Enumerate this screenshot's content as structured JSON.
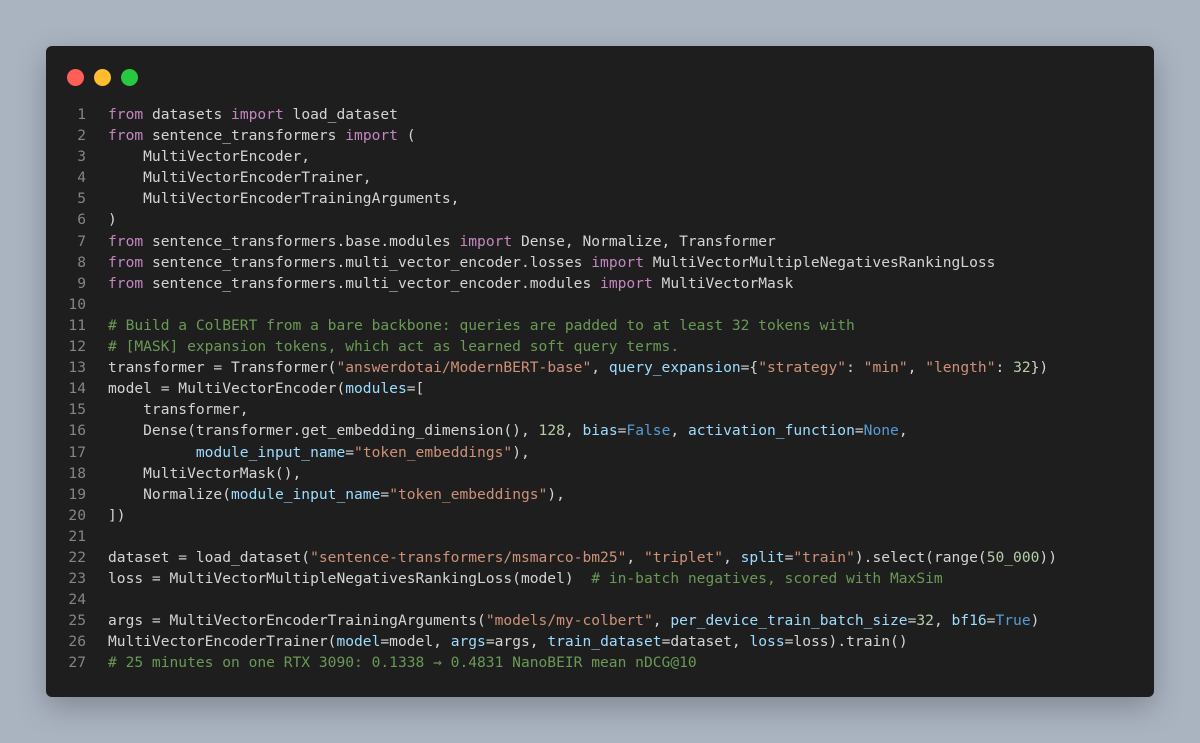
{
  "window": {
    "buttons": [
      {
        "name": "close",
        "color": "#ff5f57"
      },
      {
        "name": "minimize",
        "color": "#febc2e"
      },
      {
        "name": "maximize",
        "color": "#28c840"
      }
    ]
  },
  "colors": {
    "keyword": "#c586c0",
    "string": "#ce9178",
    "number": "#b5cea8",
    "param": "#9cdcfe",
    "constant": "#569cd6",
    "comment": "#6a9955",
    "text": "#d4d4d4"
  },
  "code_lines": [
    [
      [
        "kw",
        "from"
      ],
      [
        "t",
        " datasets "
      ],
      [
        "kw",
        "import"
      ],
      [
        "t",
        " load_dataset"
      ]
    ],
    [
      [
        "kw",
        "from"
      ],
      [
        "t",
        " sentence_transformers "
      ],
      [
        "kw",
        "import"
      ],
      [
        "t",
        " ("
      ]
    ],
    [
      [
        "t",
        "    MultiVectorEncoder,"
      ]
    ],
    [
      [
        "t",
        "    MultiVectorEncoderTrainer,"
      ]
    ],
    [
      [
        "t",
        "    MultiVectorEncoderTrainingArguments,"
      ]
    ],
    [
      [
        "t",
        ")"
      ]
    ],
    [
      [
        "kw",
        "from"
      ],
      [
        "t",
        " sentence_transformers.base.modules "
      ],
      [
        "kw",
        "import"
      ],
      [
        "t",
        " Dense, Normalize, Transformer"
      ]
    ],
    [
      [
        "kw",
        "from"
      ],
      [
        "t",
        " sentence_transformers.multi_vector_encoder.losses "
      ],
      [
        "kw",
        "import"
      ],
      [
        "t",
        " MultiVectorMultipleNegativesRankingLoss"
      ]
    ],
    [
      [
        "kw",
        "from"
      ],
      [
        "t",
        " sentence_transformers.multi_vector_encoder.modules "
      ],
      [
        "kw",
        "import"
      ],
      [
        "t",
        " MultiVectorMask"
      ]
    ],
    [],
    [
      [
        "cmt",
        "# Build a ColBERT from a bare backbone: queries are padded to at least 32 tokens with"
      ]
    ],
    [
      [
        "cmt",
        "# [MASK] expansion tokens, which act as learned soft query terms."
      ]
    ],
    [
      [
        "t",
        "transformer = Transformer("
      ],
      [
        "str",
        "\"answerdotai/ModernBERT-base\""
      ],
      [
        "t",
        ", "
      ],
      [
        "prm",
        "query_expansion"
      ],
      [
        "t",
        "={"
      ],
      [
        "str",
        "\"strategy\""
      ],
      [
        "t",
        ": "
      ],
      [
        "str",
        "\"min\""
      ],
      [
        "t",
        ", "
      ],
      [
        "str",
        "\"length\""
      ],
      [
        "t",
        ": "
      ],
      [
        "num",
        "32"
      ],
      [
        "t",
        "})"
      ]
    ],
    [
      [
        "t",
        "model = MultiVectorEncoder("
      ],
      [
        "prm",
        "modules"
      ],
      [
        "t",
        "=["
      ]
    ],
    [
      [
        "t",
        "    transformer,"
      ]
    ],
    [
      [
        "t",
        "    Dense(transformer.get_embedding_dimension(), "
      ],
      [
        "num",
        "128"
      ],
      [
        "t",
        ", "
      ],
      [
        "prm",
        "bias"
      ],
      [
        "t",
        "="
      ],
      [
        "bool",
        "False"
      ],
      [
        "t",
        ", "
      ],
      [
        "prm",
        "activation_function"
      ],
      [
        "t",
        "="
      ],
      [
        "bool",
        "None"
      ],
      [
        "t",
        ","
      ]
    ],
    [
      [
        "t",
        "          "
      ],
      [
        "prm",
        "module_input_name"
      ],
      [
        "t",
        "="
      ],
      [
        "str",
        "\"token_embeddings\""
      ],
      [
        "t",
        "),"
      ]
    ],
    [
      [
        "t",
        "    MultiVectorMask(),"
      ]
    ],
    [
      [
        "t",
        "    Normalize("
      ],
      [
        "prm",
        "module_input_name"
      ],
      [
        "t",
        "="
      ],
      [
        "str",
        "\"token_embeddings\""
      ],
      [
        "t",
        "),"
      ]
    ],
    [
      [
        "t",
        "])"
      ]
    ],
    [],
    [
      [
        "t",
        "dataset = load_dataset("
      ],
      [
        "str",
        "\"sentence-transformers/msmarco-bm25\""
      ],
      [
        "t",
        ", "
      ],
      [
        "str",
        "\"triplet\""
      ],
      [
        "t",
        ", "
      ],
      [
        "prm",
        "split"
      ],
      [
        "t",
        "="
      ],
      [
        "str",
        "\"train\""
      ],
      [
        "t",
        ").select(range("
      ],
      [
        "num",
        "50_000"
      ],
      [
        "t",
        "))"
      ]
    ],
    [
      [
        "t",
        "loss = MultiVectorMultipleNegativesRankingLoss(model)  "
      ],
      [
        "cmt",
        "# in-batch negatives, scored with MaxSim"
      ]
    ],
    [],
    [
      [
        "t",
        "args = MultiVectorEncoderTrainingArguments("
      ],
      [
        "str",
        "\"models/my-colbert\""
      ],
      [
        "t",
        ", "
      ],
      [
        "prm",
        "per_device_train_batch_size"
      ],
      [
        "t",
        "="
      ],
      [
        "num",
        "32"
      ],
      [
        "t",
        ", "
      ],
      [
        "prm",
        "bf16"
      ],
      [
        "t",
        "="
      ],
      [
        "bool",
        "True"
      ],
      [
        "t",
        ")"
      ]
    ],
    [
      [
        "t",
        "MultiVectorEncoderTrainer("
      ],
      [
        "prm",
        "model"
      ],
      [
        "t",
        "=model, "
      ],
      [
        "prm",
        "args"
      ],
      [
        "t",
        "=args, "
      ],
      [
        "prm",
        "train_dataset"
      ],
      [
        "t",
        "=dataset, "
      ],
      [
        "prm",
        "loss"
      ],
      [
        "t",
        "=loss).train()"
      ]
    ],
    [
      [
        "cmt",
        "# 25 minutes on one RTX 3090: 0.1338 → 0.4831 NanoBEIR mean nDCG@10"
      ]
    ]
  ]
}
